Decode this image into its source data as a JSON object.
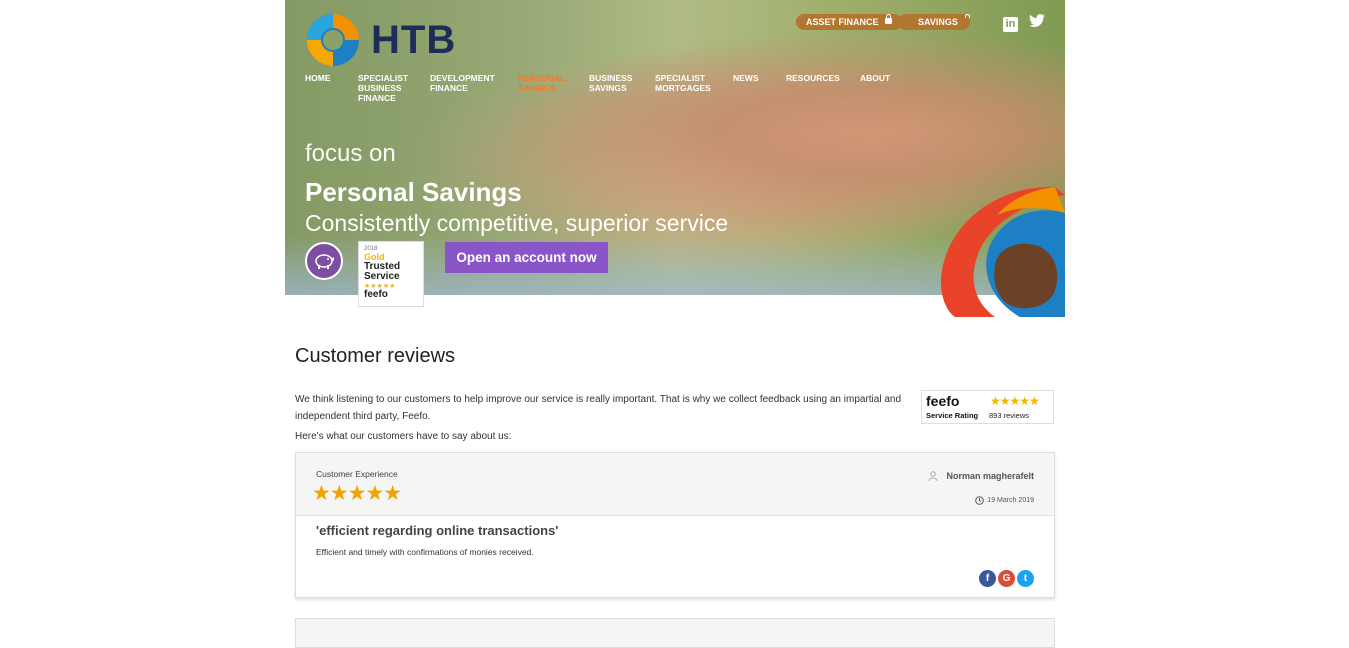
{
  "brand": {
    "name": "HTB"
  },
  "top_buttons": {
    "asset_finance": "ASSET FINANCE",
    "savings": "SAVINGS"
  },
  "social": {
    "linkedin": "in",
    "twitter": "twitter-icon"
  },
  "nav": {
    "home": "HOME",
    "specialist_business_finance_1": "SPECIALIST",
    "specialist_business_finance_2": "BUSINESS",
    "specialist_business_finance_3": "FINANCE",
    "development_finance_1": "DEVELOPMENT",
    "development_finance_2": "FINANCE",
    "personal_savings_1": "PERSONAL",
    "personal_savings_2": "SAVINGS",
    "business_savings_1": "BUSINESS",
    "business_savings_2": "SAVINGS",
    "specialist_mortgages_1": "SPECIALIST",
    "specialist_mortgages_2": "MORTGAGES",
    "news": "NEWS",
    "resources": "RESOURCES",
    "about": "ABOUT"
  },
  "hero": {
    "focus": "focus on",
    "title": "Personal Savings",
    "subtitle": "Consistently competitive, superior service",
    "cta": "Open an account now",
    "badge": {
      "year": "2018",
      "line1": "Gold",
      "line2": "Trusted",
      "line3": "Service",
      "stars": "★★★★★",
      "brand": "feefo"
    }
  },
  "reviews": {
    "title": "Customer reviews",
    "intro": "We think listening to our customers to help improve our service is really important. That is why we collect feedback using an impartial and independent third party, Feefo.",
    "intro2": "Here's what our customers have to say about us:",
    "rating": {
      "brand": "feefo",
      "label": "Service Rating",
      "count": "893 reviews",
      "stars": "★★★★★"
    },
    "card": {
      "category": "Customer Experience",
      "stars": "★★★★★",
      "reviewer": "Norman magherafelt",
      "date": "19 March 2019",
      "title": "'efficient regarding online transactions'",
      "body": "Efficient and timely with confirmations of monies received."
    }
  },
  "colors": {
    "accent_purple": "#8a55c8",
    "orange": "#f07b2c",
    "gold_button": "#b3762e",
    "star": "#f2a300"
  }
}
